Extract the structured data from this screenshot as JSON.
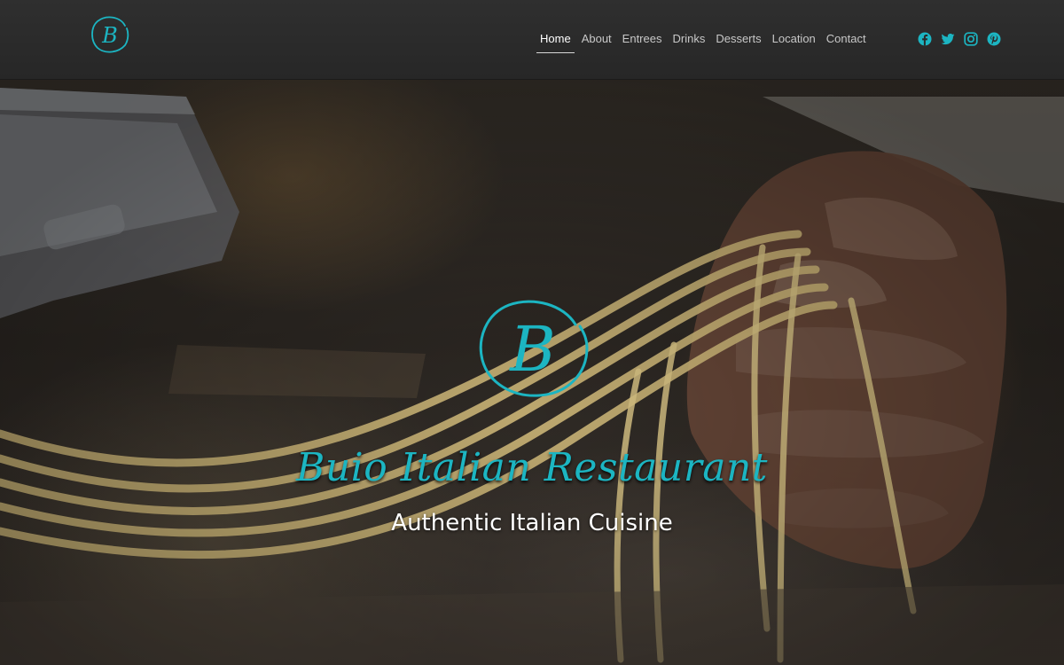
{
  "brand": {
    "logo_letter": "B",
    "accent_color": "#1cb5c2"
  },
  "nav": {
    "items": [
      {
        "label": "Home",
        "active": true
      },
      {
        "label": "About",
        "active": false
      },
      {
        "label": "Entrees",
        "active": false
      },
      {
        "label": "Drinks",
        "active": false
      },
      {
        "label": "Desserts",
        "active": false
      },
      {
        "label": "Location",
        "active": false
      },
      {
        "label": "Contact",
        "active": false
      }
    ]
  },
  "social": {
    "icons": [
      "facebook-icon",
      "twitter-icon",
      "instagram-icon",
      "pinterest-icon"
    ],
    "color": "#1cb5c2"
  },
  "hero": {
    "logo_letter": "B",
    "title": "Buio Italian Restaurant",
    "subtitle": "Authentic Italian Cuisine",
    "background_subject": "hand holding fresh pasta from pasta machine"
  }
}
